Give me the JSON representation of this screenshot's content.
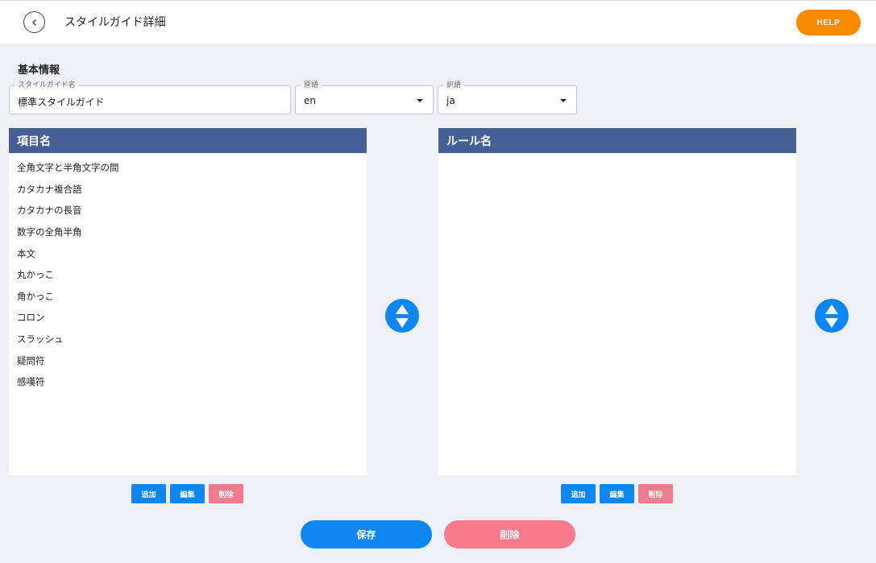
{
  "header": {
    "title": "スタイルガイド詳細",
    "help_label": "HELP"
  },
  "basic_info": {
    "section_title": "基本情報",
    "name_field": {
      "label": "スタイルガイド名",
      "value": "標準スタイルガイド"
    },
    "source_lang": {
      "label": "原語",
      "value": "en"
    },
    "target_lang": {
      "label": "訳語",
      "value": "ja"
    }
  },
  "items_panel": {
    "header": "項目名",
    "items": [
      "全角文字と半角文字の間",
      "カタカナ複合語",
      "カタカナの長音",
      "数字の全角半角",
      "本文",
      "丸かっこ",
      "角かっこ",
      "コロン",
      "スラッシュ",
      "疑問符",
      "感嘆符"
    ],
    "add_label": "追加",
    "edit_label": "編集",
    "delete_label": "削除"
  },
  "rules_panel": {
    "header": "ルール名",
    "items": [],
    "add_label": "追加",
    "edit_label": "編集",
    "delete_label": "削除"
  },
  "footer": {
    "save_label": "保存",
    "delete_label": "削除"
  },
  "colors": {
    "header_bar": "#465f94",
    "primary": "#0d86f0",
    "danger": "#f07b8c",
    "help": "#f78b00",
    "background": "#eef0f5"
  }
}
